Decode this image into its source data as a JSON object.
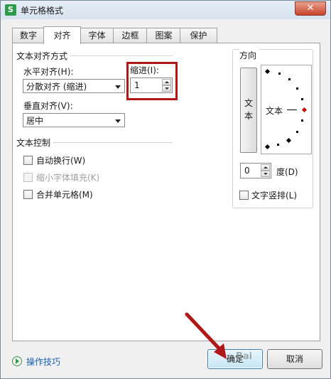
{
  "window": {
    "title": "单元格格式",
    "app_icon": "S"
  },
  "tabs": [
    {
      "label": "数字",
      "active": false
    },
    {
      "label": "对齐",
      "active": true
    },
    {
      "label": "字体",
      "active": false
    },
    {
      "label": "边框",
      "active": false
    },
    {
      "label": "图案",
      "active": false
    },
    {
      "label": "保护",
      "active": false
    }
  ],
  "alignment": {
    "group_title": "文本对齐方式",
    "horizontal_label": "水平对齐(H):",
    "horizontal_value": "分散对齐 (缩进)",
    "indent_label": "缩进(I):",
    "indent_value": "1",
    "vertical_label": "垂直对齐(V):",
    "vertical_value": "居中"
  },
  "text_control": {
    "group_title": "文本控制",
    "wrap_text": "自动换行(W)",
    "shrink_to_fit": "缩小字体填充(K)",
    "merge_cells": "合并单元格(M)"
  },
  "orientation": {
    "group_title": "方向",
    "vertical_text_char1": "文",
    "vertical_text_char2": "本",
    "dial_text": "文本",
    "degrees_value": "0",
    "degrees_label": "度(D)",
    "vertical_stack_label": "文字竖排(L)"
  },
  "footer": {
    "help_label": "操作技巧",
    "ok_label": "确定",
    "cancel_label": "取消"
  },
  "watermark": "Bai",
  "colors": {
    "annotation": "#b01717",
    "help_link": "#1a5fb4"
  }
}
